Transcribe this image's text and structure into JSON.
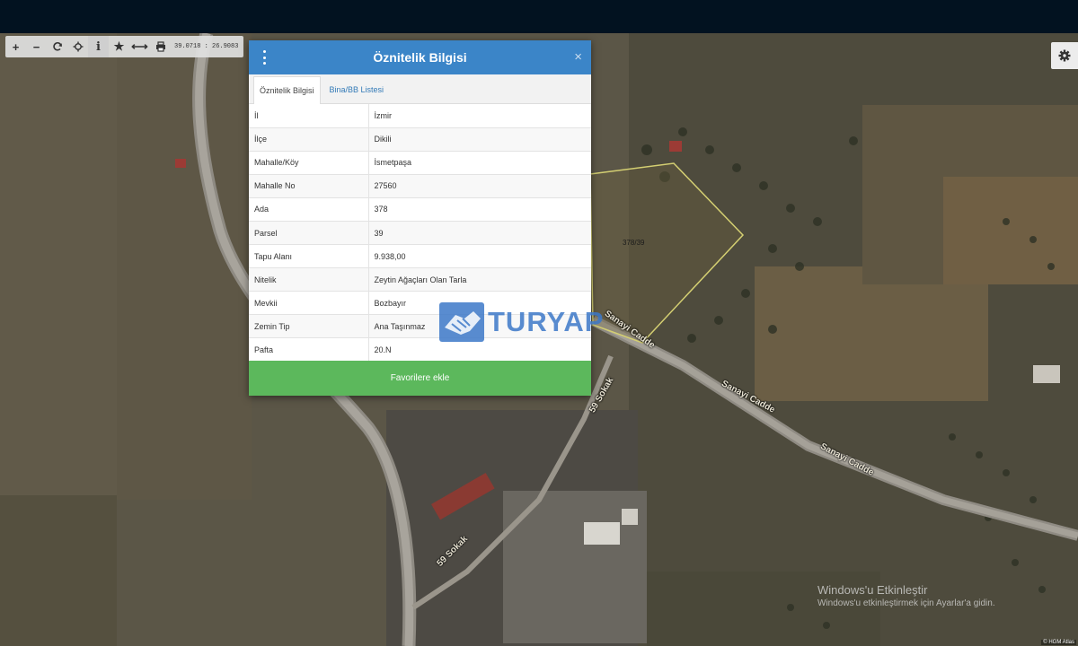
{
  "toolbar": {
    "coordinates": "39.0718 : 26.9083",
    "buttons": [
      {
        "icon": "zoom-in-icon",
        "glyph": "+"
      },
      {
        "icon": "zoom-out-icon",
        "glyph": "−"
      },
      {
        "icon": "refresh-icon"
      },
      {
        "icon": "locate-icon"
      },
      {
        "icon": "info-icon",
        "glyph": "i"
      },
      {
        "icon": "star-icon",
        "glyph": "★"
      },
      {
        "icon": "measure-icon",
        "glyph": "⟷"
      },
      {
        "icon": "print-icon"
      }
    ]
  },
  "panel": {
    "title": "Öznitelik Bilgisi",
    "close": "×",
    "tabs": [
      {
        "label": "Öznitelik Bilgisi",
        "active": true
      },
      {
        "label": "Bina/BB Listesi",
        "active": false
      }
    ],
    "rows": [
      {
        "key": "İl",
        "value": "İzmir"
      },
      {
        "key": "İlçe",
        "value": "Dikili"
      },
      {
        "key": "Mahalle/Köy",
        "value": "İsmetpaşa"
      },
      {
        "key": "Mahalle No",
        "value": "27560"
      },
      {
        "key": "Ada",
        "value": "378"
      },
      {
        "key": "Parsel",
        "value": "39"
      },
      {
        "key": "Tapu Alanı",
        "value": "9.938,00"
      },
      {
        "key": "Nitelik",
        "value": "Zeytin Ağaçları Olan Tarla"
      },
      {
        "key": "Mevkii",
        "value": "Bozbayır"
      },
      {
        "key": "Zemin Tip",
        "value": "Ana Taşınmaz"
      },
      {
        "key": "Pafta",
        "value": "20.N"
      }
    ],
    "favorite_button": "Favorilere ekle"
  },
  "map": {
    "parcel_label": "378/39",
    "road_labels": [
      "Sanayi Cadde",
      "Sanayi Cadde",
      "59 Sokak",
      "59 Sokak",
      "Sanayi Cadde"
    ],
    "parcel_outline_color": "#d4cf72"
  },
  "watermark": {
    "text": "TURYAP"
  },
  "windows_notice": {
    "title": "Windows'u Etkinleştir",
    "subtitle": "Windows'u etkinleştirmek için Ayarlar'a gidin."
  },
  "copyright": "© HGM Atlas"
}
